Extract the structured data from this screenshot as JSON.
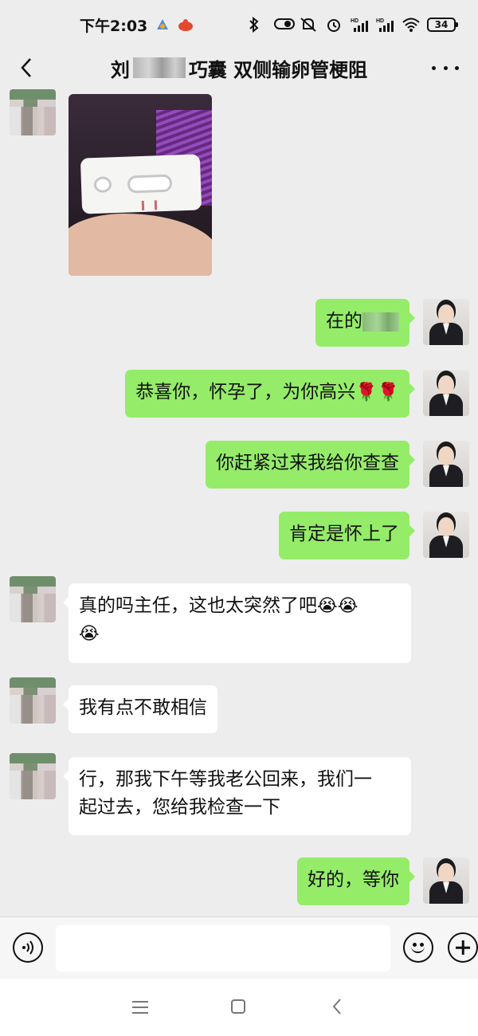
{
  "status_bar": {
    "time": "下午2:03",
    "battery": "34",
    "icons": [
      "bluetooth-icon",
      "toggle-icon",
      "mute-icon",
      "alarm-icon",
      "hd-signal-icon",
      "hd-signal-icon",
      "wifi-icon",
      "battery-icon"
    ]
  },
  "header": {
    "title_prefix": "刘",
    "title_suffix": "巧囊 双侧输卵管梗阻",
    "back_icon": "chevron-left-icon",
    "more_icon": "more-dots-icon"
  },
  "messages": [
    {
      "side": "in",
      "type": "image"
    },
    {
      "side": "out",
      "text_visible": "在的"
    },
    {
      "side": "out",
      "text": "恭喜你，怀孕了，为你高兴",
      "emoji": "🌹🌹"
    },
    {
      "side": "out",
      "text": "你赶紧过来我给你查查"
    },
    {
      "side": "out",
      "text": "肯定是怀上了"
    },
    {
      "side": "in",
      "text": "真的吗主任，这也太突然了吧",
      "emoji": "😭😭",
      "emoji2": "😭"
    },
    {
      "side": "in",
      "text": "我有点不敢相信"
    },
    {
      "side": "in",
      "line1": "行，那我下午等我老公回来，我们一",
      "line2": "起过去，您给我检查一下"
    },
    {
      "side": "out",
      "text": "好的，等你"
    }
  ],
  "input_bar": {
    "placeholder": "",
    "value": ""
  },
  "colors": {
    "background": "#ededed",
    "outgoing_bubble": "#95ec69",
    "incoming_bubble": "#ffffff"
  }
}
